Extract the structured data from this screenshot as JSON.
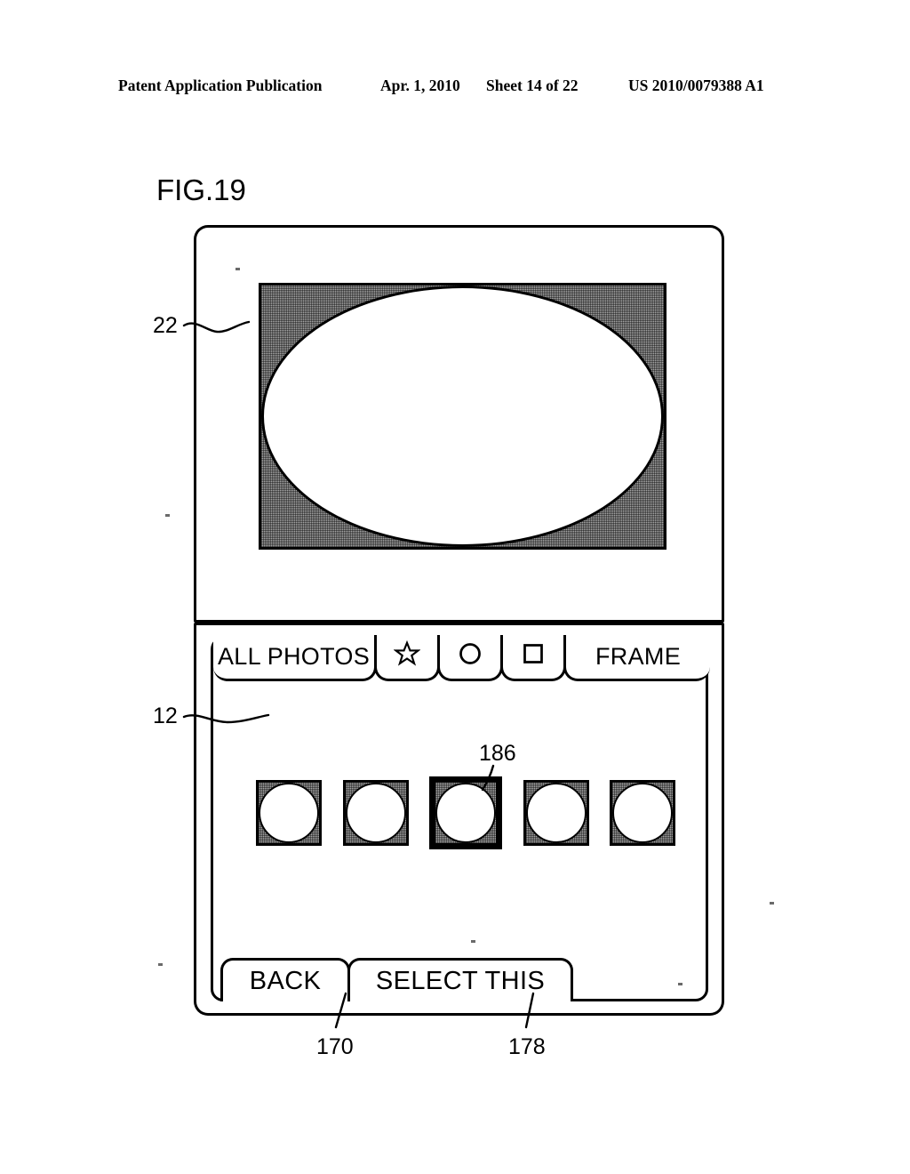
{
  "header": {
    "publication": "Patent Application Publication",
    "date": "Apr. 1, 2010",
    "sheet": "Sheet 14 of 22",
    "patent_number": "US 2010/0079388 A1"
  },
  "figure": {
    "title": "FIG.19"
  },
  "device": {
    "upper_panel_ref": "22",
    "lower_panel_ref": "12"
  },
  "preview": {
    "shape": "ellipse",
    "background": "halftone-gray",
    "fill_color": "#ffffff"
  },
  "tabs": [
    {
      "label": "ALL PHOTOS",
      "icon": null,
      "selected": false
    },
    {
      "label": "☆",
      "icon": "star-icon",
      "selected": false
    },
    {
      "label": "○",
      "icon": "circle-icon",
      "selected": false
    },
    {
      "label": "□",
      "icon": "square-icon",
      "selected": false
    },
    {
      "label": "FRAME",
      "icon": null,
      "selected": false
    }
  ],
  "thumbnails": {
    "ref": "186",
    "items": [
      {
        "shape": "circle",
        "selected": false
      },
      {
        "shape": "circle",
        "selected": false
      },
      {
        "shape": "circle",
        "selected": true
      },
      {
        "shape": "circle",
        "selected": false
      },
      {
        "shape": "circle",
        "selected": false
      }
    ]
  },
  "buttons": [
    {
      "label": "BACK",
      "ref": "170"
    },
    {
      "label": "SELECT THIS",
      "ref": "178"
    }
  ],
  "colors": {
    "ink": "#000000",
    "paper": "#ffffff",
    "halftone": "#a8a8a8"
  }
}
